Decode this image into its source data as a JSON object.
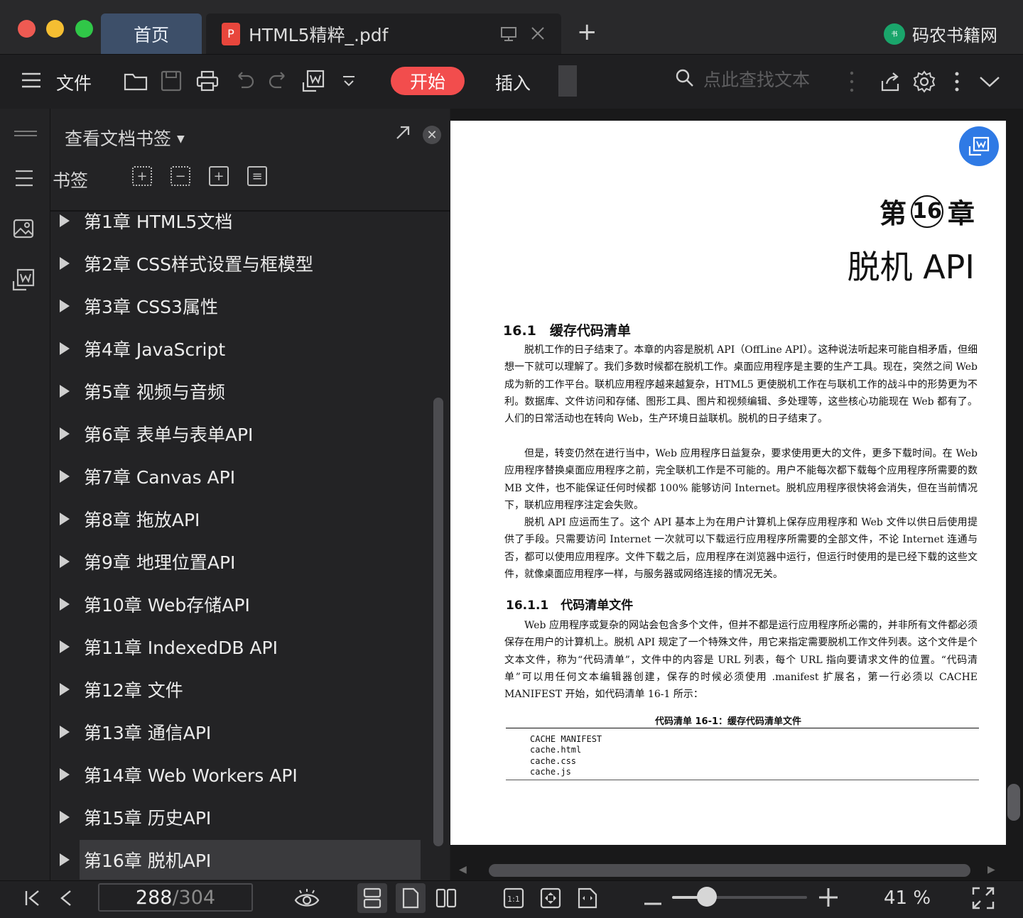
{
  "window": {
    "traffic_lights": [
      "#ee5a52",
      "#f5be32",
      "#30c748"
    ],
    "tabs": [
      {
        "label": "首页",
        "active": false
      },
      {
        "label": "HTML5精粹_.pdf",
        "active": true
      }
    ],
    "brand": "码农书籍网"
  },
  "toolbar": {
    "menu_label": "文件",
    "start_label": "开始",
    "insert_label": "插入",
    "search_placeholder": "点此查找文本",
    "accent": "#f24d4d"
  },
  "sidebar": {
    "title": "查看文档书签",
    "bookmarks_label": "书签",
    "items": [
      {
        "label": "第1章 HTML5文档"
      },
      {
        "label": "第2章 CSS样式设置与框模型"
      },
      {
        "label": "第3章 CSS3属性"
      },
      {
        "label": "第4章 JavaScript"
      },
      {
        "label": "第5章 视频与音频"
      },
      {
        "label": "第6章 表单与表单API"
      },
      {
        "label": "第7章 Canvas API"
      },
      {
        "label": "第8章 拖放API"
      },
      {
        "label": "第9章 地理位置API"
      },
      {
        "label": "第10章 Web存储API"
      },
      {
        "label": "第11章 IndexedDB API"
      },
      {
        "label": "第12章 文件"
      },
      {
        "label": "第13章 通信API"
      },
      {
        "label": "第14章 Web Workers API"
      },
      {
        "label": "第15章 历史API"
      },
      {
        "label": "第16章 脱机API",
        "selected": true
      }
    ]
  },
  "document": {
    "chapter_prefix": "第",
    "chapter_number": "16",
    "chapter_suffix": "章",
    "chapter_title": "脱机 API",
    "section_1": "16.1　缓存代码清单",
    "paragraphs": [
      "脱机工作的日子结束了。本章的内容是脱机 API（OffLine API）。这种说法听起来可能自相矛盾，但细想一下就可以理解了。我们多数时候都在脱机工作。桌面应用程序是主要的生产工具。现在，突然之间 Web 成为新的工作平台。联机应用程序越来越复杂，HTML5 更使脱机工作在与联机工作的战斗中的形势更为不利。数据库、文件访问和存储、图形工具、图片和视频编辑、多处理等，这些核心功能现在 Web 都有了。人们的日常活动也在转向 Web，生产环境日益联机。脱机的日子结束了。",
      "但是，转变仍然在进行当中，Web 应用程序日益复杂，要求使用更大的文件，更多下载时间。在 Web 应用程序替换桌面应用程序之前，完全联机工作是不可能的。用户不能每次都下载每个应用程序所需要的数 MB 文件，也不能保证任何时候都 100% 能够访问 Internet。脱机应用程序很快将会消失，但在当前情况下，联机应用程序注定会失败。",
      "脱机 API 应运而生了。这个 API 基本上为在用户计算机上保存应用程序和 Web 文件以供日后使用提供了手段。只需要访问 Internet 一次就可以下载运行应用程序所需要的全部文件，不论 Internet 连通与否，都可以使用应用程序。文件下载之后，应用程序在浏览器中运行，但运行时使用的是已经下载的这些文件，就像桌面应用程序一样，与服务器或网络连接的情况无关。"
    ],
    "section_2": "16.1.1　代码清单文件",
    "paragraph_4": "Web 应用程序或复杂的网站会包含多个文件，但并不都是运行应用程序所必需的，并非所有文件都必须保存在用户的计算机上。脱机 API 规定了一个特殊文件，用它来指定需要脱机工作文件列表。这个文件是个文本文件，称为“代码清单”，文件中的内容是 URL 列表，每个 URL 指向要请求文件的位置。“代码清单”可以用任何文本编辑器创建，保存的时候必须使用 .manifest 扩展名，第一行必须以 CACHE MANIFEST 开始，如代码清单 16-1 所示：",
    "code_caption": "代码清单 16-1：缓存代码清单文件",
    "code_lines": [
      "CACHE MANIFEST",
      "cache.html",
      "cache.css",
      "cache.js"
    ]
  },
  "statusbar": {
    "current_page": "288",
    "page_separator": "/",
    "total_pages": "304",
    "zoom_percent": "41 %",
    "zoom_level": 0.26
  }
}
